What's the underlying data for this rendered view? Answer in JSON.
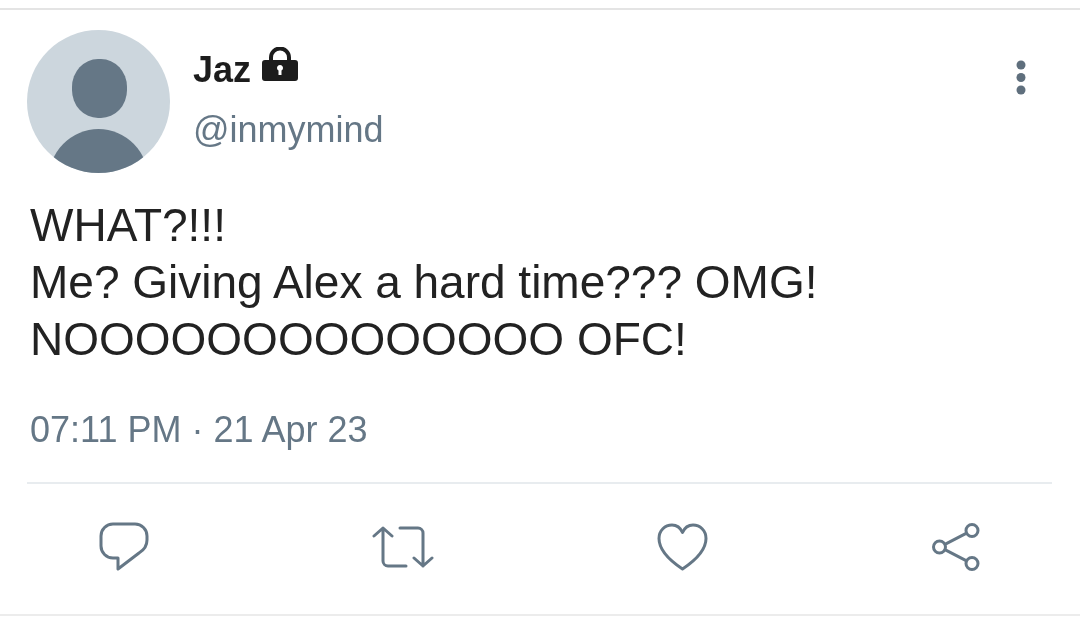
{
  "author": {
    "name": "Jaz",
    "locked": true,
    "handle": "@inmymind"
  },
  "tweet": {
    "text": "WHAT?!!!\nMe? Giving Alex a hard time??? OMG!\nNOOOOOOOOOOOOOO OFC!",
    "timestamp": "07:11 PM · 21 Apr 23"
  }
}
